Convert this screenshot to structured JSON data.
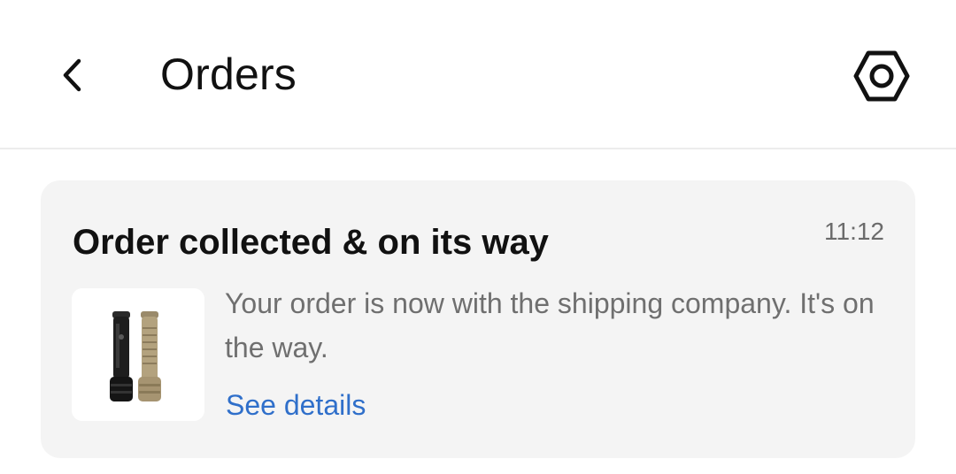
{
  "header": {
    "title": "Orders",
    "back_icon": "chevron-left-icon",
    "settings_icon": "hexagon-settings-icon"
  },
  "notification": {
    "title": "Order collected & on its way",
    "time": "11:12",
    "message": "Your order is now with the shipping company. It's on the way.",
    "link_label": "See details",
    "thumbnail": "flashlight-product-image"
  },
  "colors": {
    "link": "#2f6fca",
    "card_background": "#f4f4f4",
    "text_primary": "#111111",
    "text_secondary": "#6f6f6f"
  }
}
